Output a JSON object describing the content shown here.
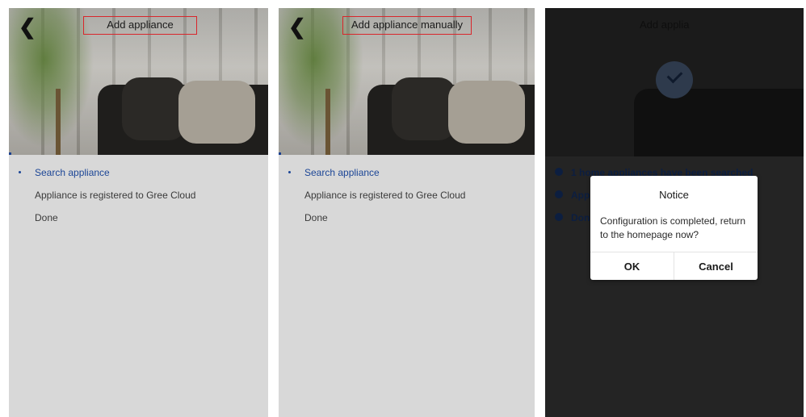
{
  "panel1": {
    "title": "Add appliance",
    "back_glyph": "❮",
    "steps": [
      {
        "label": "Search appliance",
        "active": true
      },
      {
        "label": "Appliance is registered to Gree Cloud",
        "active": false
      },
      {
        "label": "Done",
        "active": false
      }
    ]
  },
  "panel2": {
    "title": "Add appliance manually",
    "back_glyph": "❮",
    "steps": [
      {
        "label": "Search appliance",
        "active": true
      },
      {
        "label": "Appliance is registered to Gree Cloud",
        "active": false
      },
      {
        "label": "Done",
        "active": false
      }
    ]
  },
  "panel3": {
    "title": "Add applia",
    "steps": [
      {
        "label": "1 home appliances have been searched"
      },
      {
        "label": "Appli"
      },
      {
        "label": "Don"
      }
    ],
    "dialog": {
      "title": "Notice",
      "message": "Configuration is completed, return to the homepage now?",
      "ok_label": "OK",
      "cancel_label": "Cancel"
    }
  },
  "colors": {
    "accent": "#1b4596",
    "highlight_box": "#d9262c",
    "panel_bg": "#d8d8d8",
    "overlay_bg": "#242424"
  },
  "icons": {
    "back": "chevron-left-icon",
    "success": "checkmark-icon"
  }
}
